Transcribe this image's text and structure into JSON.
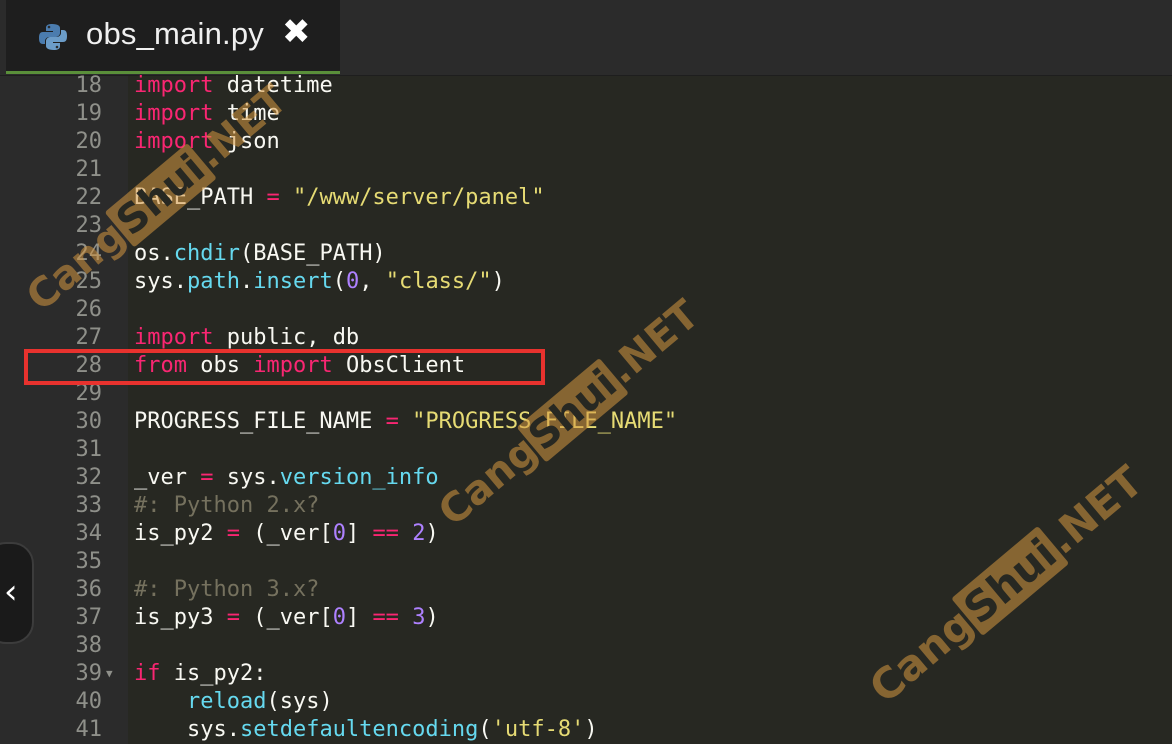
{
  "tab": {
    "title": "obs_main.py",
    "close_glyph": "✖",
    "icon": "python-icon"
  },
  "side_handle": {
    "glyph": "‹",
    "icon": "chevron-left-icon"
  },
  "highlighted_line": "28",
  "watermarks": [
    {
      "a": "Cang",
      "b": "Shui",
      "c": ".NET"
    },
    {
      "a": "Cang",
      "b": "Shui",
      "c": ".NET"
    },
    {
      "a": "Cang",
      "b": "Shui",
      "c": ".NET"
    }
  ],
  "lines": [
    {
      "n": "18",
      "tokens": [
        {
          "t": "import",
          "c": "kw"
        },
        {
          "t": " datetime",
          "c": ""
        }
      ]
    },
    {
      "n": "19",
      "tokens": [
        {
          "t": "import",
          "c": "kw"
        },
        {
          "t": " time",
          "c": ""
        }
      ]
    },
    {
      "n": "20",
      "tokens": [
        {
          "t": "import",
          "c": "kw"
        },
        {
          "t": " json",
          "c": ""
        }
      ]
    },
    {
      "n": "21",
      "tokens": []
    },
    {
      "n": "22",
      "tokens": [
        {
          "t": "BASE_PATH ",
          "c": ""
        },
        {
          "t": "=",
          "c": "op"
        },
        {
          "t": " ",
          "c": ""
        },
        {
          "t": "\"/www/server/panel\"",
          "c": "str"
        }
      ]
    },
    {
      "n": "23",
      "tokens": []
    },
    {
      "n": "24",
      "tokens": [
        {
          "t": "os.",
          "c": ""
        },
        {
          "t": "chdir",
          "c": "fn"
        },
        {
          "t": "(BASE_PATH)",
          "c": ""
        }
      ]
    },
    {
      "n": "25",
      "tokens": [
        {
          "t": "sys.",
          "c": ""
        },
        {
          "t": "path",
          "c": "fn"
        },
        {
          "t": ".",
          "c": ""
        },
        {
          "t": "insert",
          "c": "fn"
        },
        {
          "t": "(",
          "c": ""
        },
        {
          "t": "0",
          "c": "num"
        },
        {
          "t": ", ",
          "c": ""
        },
        {
          "t": "\"class/\"",
          "c": "str"
        },
        {
          "t": ")",
          "c": ""
        }
      ]
    },
    {
      "n": "26",
      "tokens": []
    },
    {
      "n": "27",
      "tokens": [
        {
          "t": "import",
          "c": "kw"
        },
        {
          "t": " public, db",
          "c": ""
        }
      ]
    },
    {
      "n": "28",
      "tokens": [
        {
          "t": "from",
          "c": "kw"
        },
        {
          "t": " obs ",
          "c": ""
        },
        {
          "t": "import",
          "c": "kw"
        },
        {
          "t": " ObsClient",
          "c": ""
        }
      ]
    },
    {
      "n": "29",
      "tokens": []
    },
    {
      "n": "30",
      "tokens": [
        {
          "t": "PROGRESS_FILE_NAME ",
          "c": ""
        },
        {
          "t": "=",
          "c": "op"
        },
        {
          "t": " ",
          "c": ""
        },
        {
          "t": "\"PROGRESS_FILE_NAME\"",
          "c": "str"
        }
      ]
    },
    {
      "n": "31",
      "tokens": []
    },
    {
      "n": "32",
      "tokens": [
        {
          "t": "_ver ",
          "c": ""
        },
        {
          "t": "=",
          "c": "op"
        },
        {
          "t": " sys.",
          "c": ""
        },
        {
          "t": "version_info",
          "c": "fn"
        }
      ]
    },
    {
      "n": "33",
      "tokens": [
        {
          "t": "#: Python 2.x?",
          "c": "cm"
        }
      ]
    },
    {
      "n": "34",
      "tokens": [
        {
          "t": "is_py2 ",
          "c": ""
        },
        {
          "t": "=",
          "c": "op"
        },
        {
          "t": " (_ver[",
          "c": ""
        },
        {
          "t": "0",
          "c": "num"
        },
        {
          "t": "] ",
          "c": ""
        },
        {
          "t": "==",
          "c": "op"
        },
        {
          "t": " ",
          "c": ""
        },
        {
          "t": "2",
          "c": "num"
        },
        {
          "t": ")",
          "c": ""
        }
      ]
    },
    {
      "n": "35",
      "tokens": []
    },
    {
      "n": "36",
      "tokens": [
        {
          "t": "#: Python 3.x?",
          "c": "cm"
        }
      ]
    },
    {
      "n": "37",
      "tokens": [
        {
          "t": "is_py3 ",
          "c": ""
        },
        {
          "t": "=",
          "c": "op"
        },
        {
          "t": " (_ver[",
          "c": ""
        },
        {
          "t": "0",
          "c": "num"
        },
        {
          "t": "] ",
          "c": ""
        },
        {
          "t": "==",
          "c": "op"
        },
        {
          "t": " ",
          "c": ""
        },
        {
          "t": "3",
          "c": "num"
        },
        {
          "t": ")",
          "c": ""
        }
      ]
    },
    {
      "n": "38",
      "tokens": []
    },
    {
      "n": "39",
      "fold": true,
      "tokens": [
        {
          "t": "if",
          "c": "kw"
        },
        {
          "t": " is_py2:",
          "c": ""
        }
      ]
    },
    {
      "n": "40",
      "tokens": [
        {
          "t": "    ",
          "c": ""
        },
        {
          "t": "reload",
          "c": "fn"
        },
        {
          "t": "(sys)",
          "c": ""
        }
      ]
    },
    {
      "n": "41",
      "tokens": [
        {
          "t": "    sys.",
          "c": ""
        },
        {
          "t": "setdefaultencoding",
          "c": "fn"
        },
        {
          "t": "(",
          "c": ""
        },
        {
          "t": "'utf-8'",
          "c": "str"
        },
        {
          "t": ")",
          "c": ""
        }
      ]
    }
  ]
}
